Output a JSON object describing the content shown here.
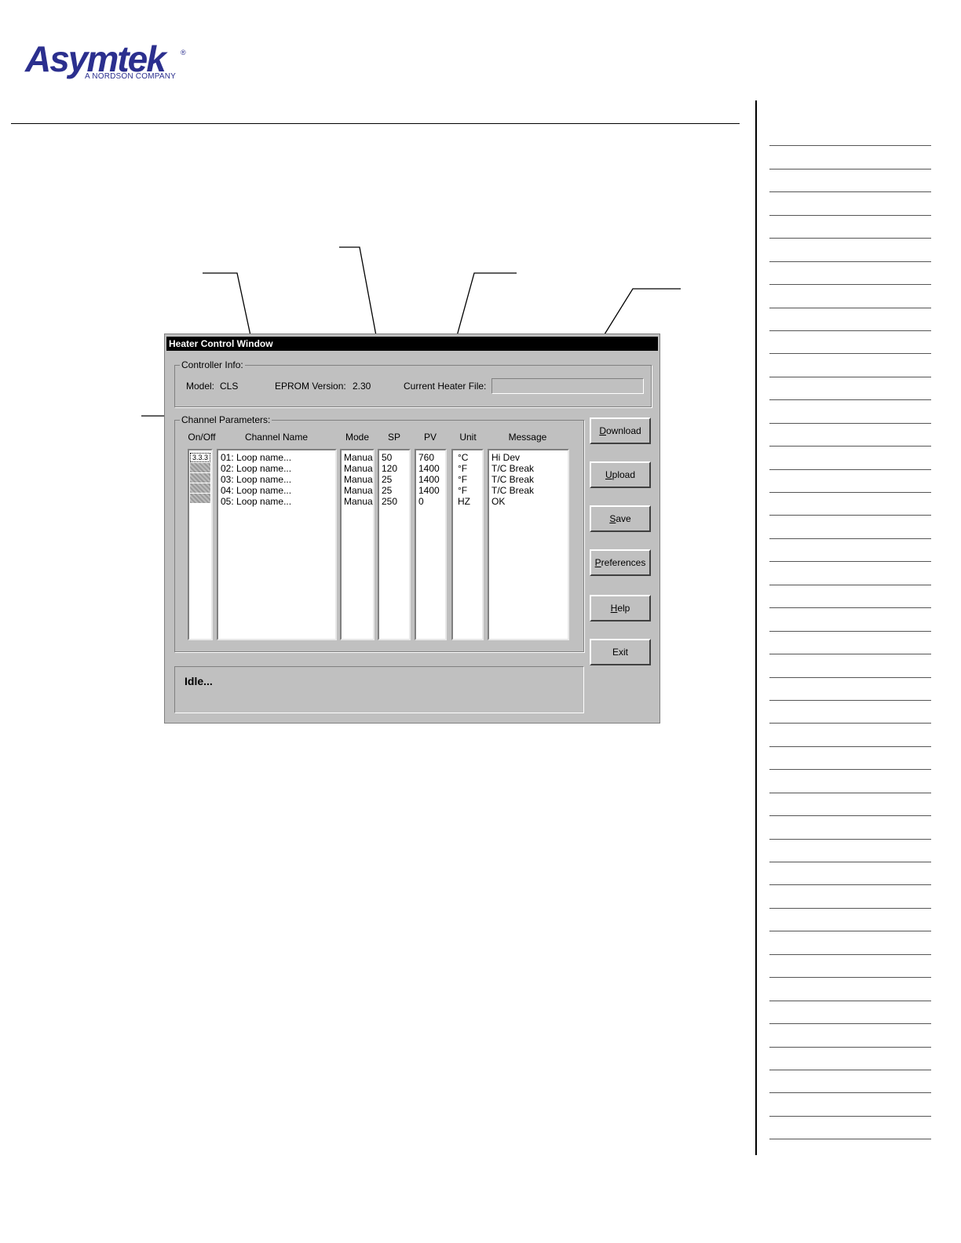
{
  "logo": {
    "word": "Asymtek",
    "registered": "®",
    "tagline": "A NORDSON COMPANY"
  },
  "window": {
    "title": "Heater Control Window",
    "controller_info": {
      "label": "Controller Info:",
      "model_label": "Model:",
      "model_value": "CLS",
      "eprom_label": "EPROM Version:",
      "eprom_value": "2.30",
      "heater_file_label": "Current Heater File:",
      "heater_file_value": ""
    },
    "channel_parameters": {
      "label": "Channel Parameters:",
      "headers": {
        "onoff": "On/Off",
        "name": "Channel Name",
        "mode": "Mode",
        "sp": "SP",
        "pv": "PV",
        "unit": "Unit",
        "message": "Message"
      },
      "rows": [
        {
          "name": "01: Loop name...",
          "mode": "Manual",
          "sp": "50",
          "pv": "760",
          "unit": "°C",
          "message": "Hi Dev"
        },
        {
          "name": "02: Loop name...",
          "mode": "Manual",
          "sp": "120",
          "pv": "1400",
          "unit": "°F",
          "message": "T/C Break"
        },
        {
          "name": "03: Loop name...",
          "mode": "Manual",
          "sp": "25",
          "pv": "1400",
          "unit": "°F",
          "message": "T/C Break"
        },
        {
          "name": "04: Loop name...",
          "mode": "Manual",
          "sp": "25",
          "pv": "1400",
          "unit": "°F",
          "message": "T/C Break"
        },
        {
          "name": "05: Loop name...",
          "mode": "Manual",
          "sp": "250",
          "pv": "0",
          "unit": "HZ",
          "message": "OK"
        }
      ],
      "first_switch_text": "3.3.3"
    },
    "buttons": {
      "download": "Download",
      "upload": "Upload",
      "save": "Save",
      "preferences": "Preferences",
      "help": "Help",
      "exit": "Exit"
    },
    "status": "Idle..."
  }
}
